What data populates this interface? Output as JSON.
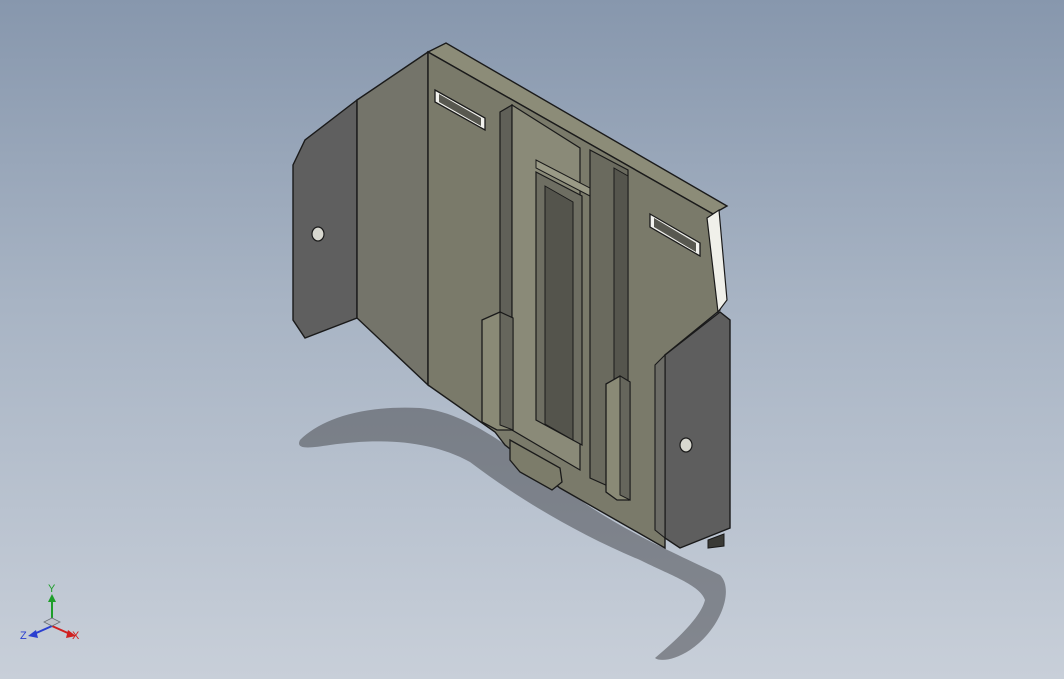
{
  "viewport": {
    "background_top": "#8797ad",
    "background_bottom": "#c8cfd9",
    "model_face_color": "#7a7a6a",
    "model_side_color": "#5e5e5e",
    "model_edge_color": "#1a1a1a"
  },
  "triad": {
    "x_label": "X",
    "y_label": "Y",
    "z_label": "Z",
    "x_color": "#d02020",
    "y_color": "#1e9e2a",
    "z_color": "#2a3fd0"
  }
}
